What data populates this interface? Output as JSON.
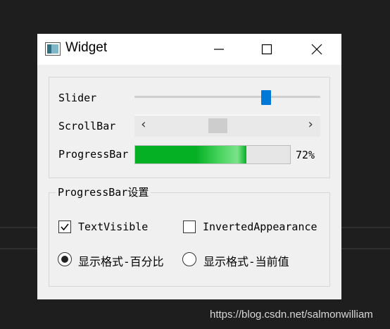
{
  "window": {
    "title": "Widget"
  },
  "controls": {
    "slider": {
      "label": "Slider",
      "value_fraction": 0.72
    },
    "scrollbar": {
      "label": "ScrollBar",
      "left_arrow": "‹",
      "right_arrow": "›",
      "value_fraction": 0.43
    },
    "progressbar": {
      "label": "ProgressBar",
      "value_percent": 72,
      "text": "72%"
    }
  },
  "settings_group": {
    "title": "ProgressBar设置",
    "text_visible": {
      "label": "TextVisible",
      "checked": true
    },
    "inverted_appearance": {
      "label": "InvertedAppearance",
      "checked": false
    },
    "format_percent": {
      "label": "显示格式-百分比",
      "selected": true
    },
    "format_current": {
      "label": "显示格式-当前值",
      "selected": false
    }
  },
  "watermark": "https://blog.csdn.net/salmonwilliam",
  "colors": {
    "accent": "#0078d7",
    "progress": "#06b025"
  }
}
